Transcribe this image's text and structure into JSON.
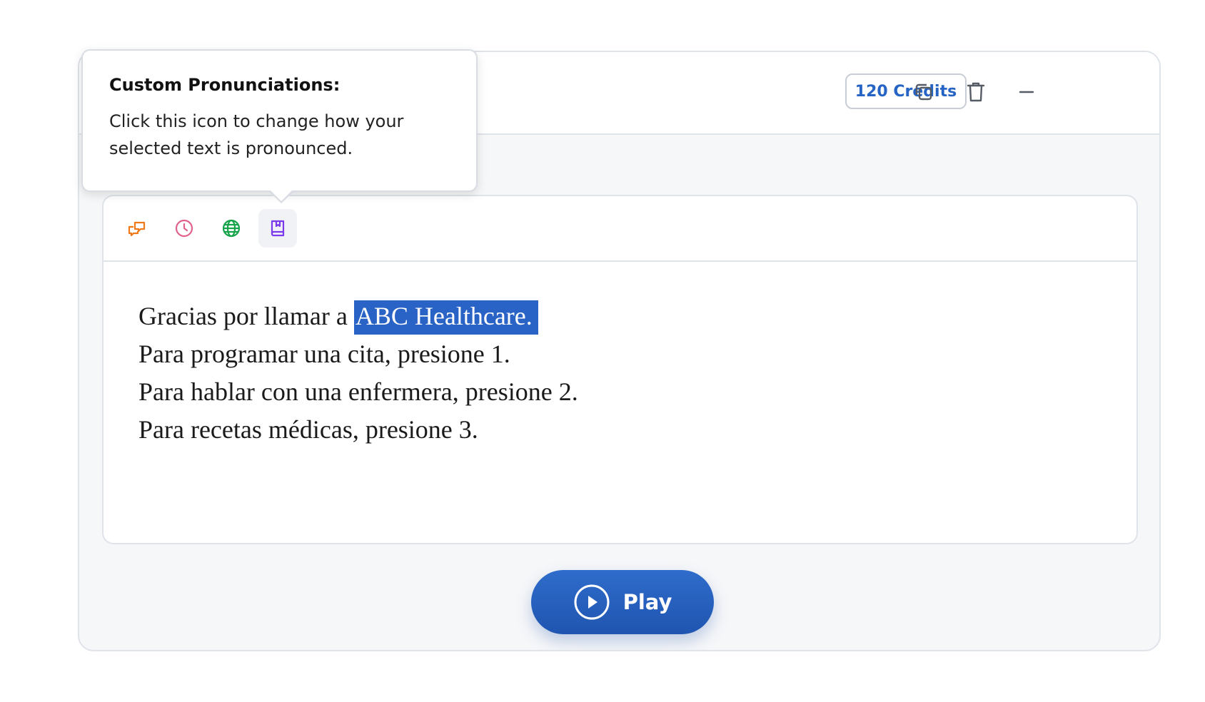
{
  "header": {
    "credits_label": "120 Credits",
    "actions": {
      "duplicate_icon": "duplicate-icon",
      "delete_icon": "trash-icon",
      "collapse_icon": "minus-icon"
    }
  },
  "toolbar": {
    "tools": [
      {
        "name": "conversation-icon",
        "color": "#f07a1a"
      },
      {
        "name": "clock-icon",
        "color": "#e0628a"
      },
      {
        "name": "globe-icon",
        "color": "#16a34a"
      },
      {
        "name": "book-icon",
        "color": "#7c3aed",
        "active": true
      }
    ]
  },
  "editor": {
    "lines": [
      {
        "before": "Gracias por llamar a ",
        "selected": "ABC Healthcare."
      },
      {
        "text": "Para programar una cita, presione 1."
      },
      {
        "text": "Para hablar con una enfermera, presione 2."
      },
      {
        "text": "Para recetas médicas, presione 3."
      }
    ],
    "selection_color": "#2a63c6"
  },
  "play_button": {
    "label": "Play",
    "color": "#2a63c6"
  },
  "tooltip": {
    "title": "Custom Pronunciations:",
    "body": "Click this icon to change how your selected text is pronounced."
  }
}
